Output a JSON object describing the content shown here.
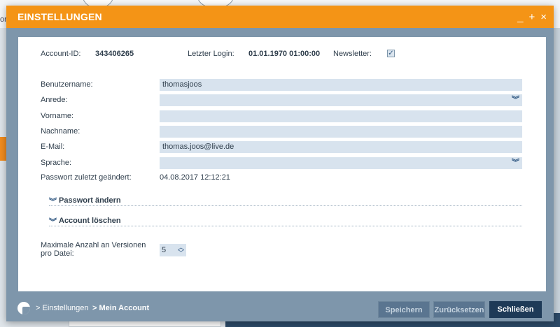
{
  "background": {
    "left_text": "or"
  },
  "dialog": {
    "title": "EINSTELLUNGEN",
    "controls": {
      "minimize": "_",
      "maximize": "+",
      "close": "×"
    }
  },
  "account": {
    "id_label": "Account-ID:",
    "id_value": "343406265",
    "login_label": "Letzter Login:",
    "login_value": "01.01.1970 01:00:00",
    "newsletter_label": "Newsletter:",
    "newsletter_checked": true,
    "check_mark": "✓"
  },
  "form": {
    "username_label": "Benutzername:",
    "username_value": "thomasjoos",
    "salutation_label": "Anrede:",
    "salutation_value": "",
    "firstname_label": "Vorname:",
    "firstname_value": "",
    "lastname_label": "Nachname:",
    "lastname_value": "",
    "email_label": "E-Mail:",
    "email_value": "thomas.joos@live.de",
    "language_label": "Sprache:",
    "language_value": "",
    "pw_changed_label": "Passwort zuletzt geändert:",
    "pw_changed_value": "04.08.2017 12:12:21",
    "chevron": "︾"
  },
  "sections": {
    "change_password": "Passwort ändern",
    "delete_account": "Account löschen"
  },
  "versions": {
    "label": "Maximale Anzahl an Versionen pro Datei:",
    "value": "5"
  },
  "footer": {
    "crumb_settings": "> Einstellungen",
    "crumb_account": "> Mein Account",
    "save": "Speichern",
    "reset": "Zurücksetzen",
    "close": "Schließen"
  }
}
